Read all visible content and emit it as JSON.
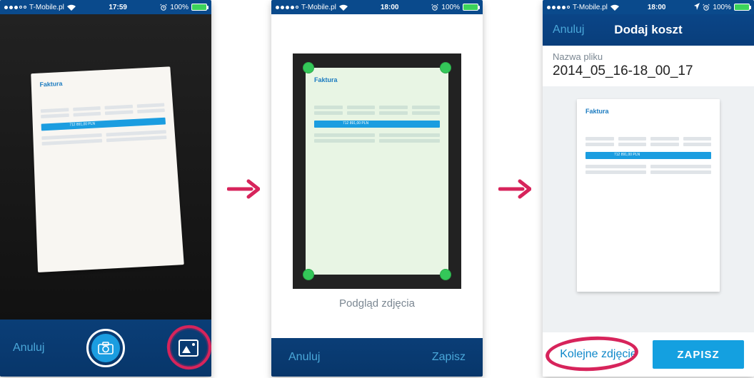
{
  "statusbar": {
    "carrier": "T-Mobile.pl",
    "time_1": "17:59",
    "time_2": "18:00",
    "time_3": "18:00",
    "battery_pct": "100%"
  },
  "invoice": {
    "heading": "Faktura",
    "total_label": "712 891,00 PLN"
  },
  "screen1": {
    "cancel": "Anuluj"
  },
  "screen2": {
    "caption": "Podgląd zdjęcia",
    "cancel": "Anuluj",
    "save": "Zapisz"
  },
  "screen3": {
    "nav_back": "Anuluj",
    "nav_title": "Dodaj koszt",
    "field_label": "Nazwa pliku",
    "field_value": "2014_05_16-18_00_17",
    "next_photo": "Kolejne zdjęcie",
    "save": "ZAPISZ"
  }
}
